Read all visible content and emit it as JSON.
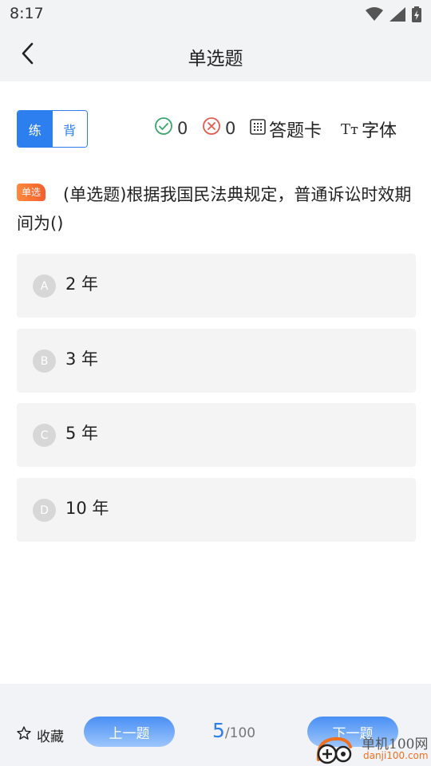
{
  "status_bar": {
    "time": "8:17",
    "icons": [
      "wifi-icon",
      "signal-icon",
      "battery-icon"
    ]
  },
  "header": {
    "title": "单选题",
    "back_icon": "chevron-left-icon"
  },
  "mode_toggle": {
    "practice_label": "练",
    "memorize_label": "背",
    "active": "practice"
  },
  "stats": {
    "correct_count": "0",
    "wrong_count": "0"
  },
  "tools": {
    "answer_card_label": "答题卡",
    "font_glyph": "Tт",
    "font_label": "字体"
  },
  "question": {
    "badge": "单选",
    "text": "(单选题)根据我国民法典规定，普通诉讼时效期间为()"
  },
  "options": [
    {
      "letter": "A",
      "text": "2 年"
    },
    {
      "letter": "B",
      "text": "3 年"
    },
    {
      "letter": "C",
      "text": "5 年"
    },
    {
      "letter": "D",
      "text": "10 年"
    }
  ],
  "bottom_bar": {
    "favorite_label": "收藏",
    "prev_label": "上一题",
    "next_label": "下一题",
    "current_page": "5",
    "total_pages": "/100"
  },
  "watermark": {
    "site_cn": "单机100网",
    "site_url": "danji100.com"
  },
  "colors": {
    "accent": "#2d7ff0",
    "correct": "#3aa76d",
    "wrong": "#e55a4e",
    "badge": "#f56a30"
  }
}
